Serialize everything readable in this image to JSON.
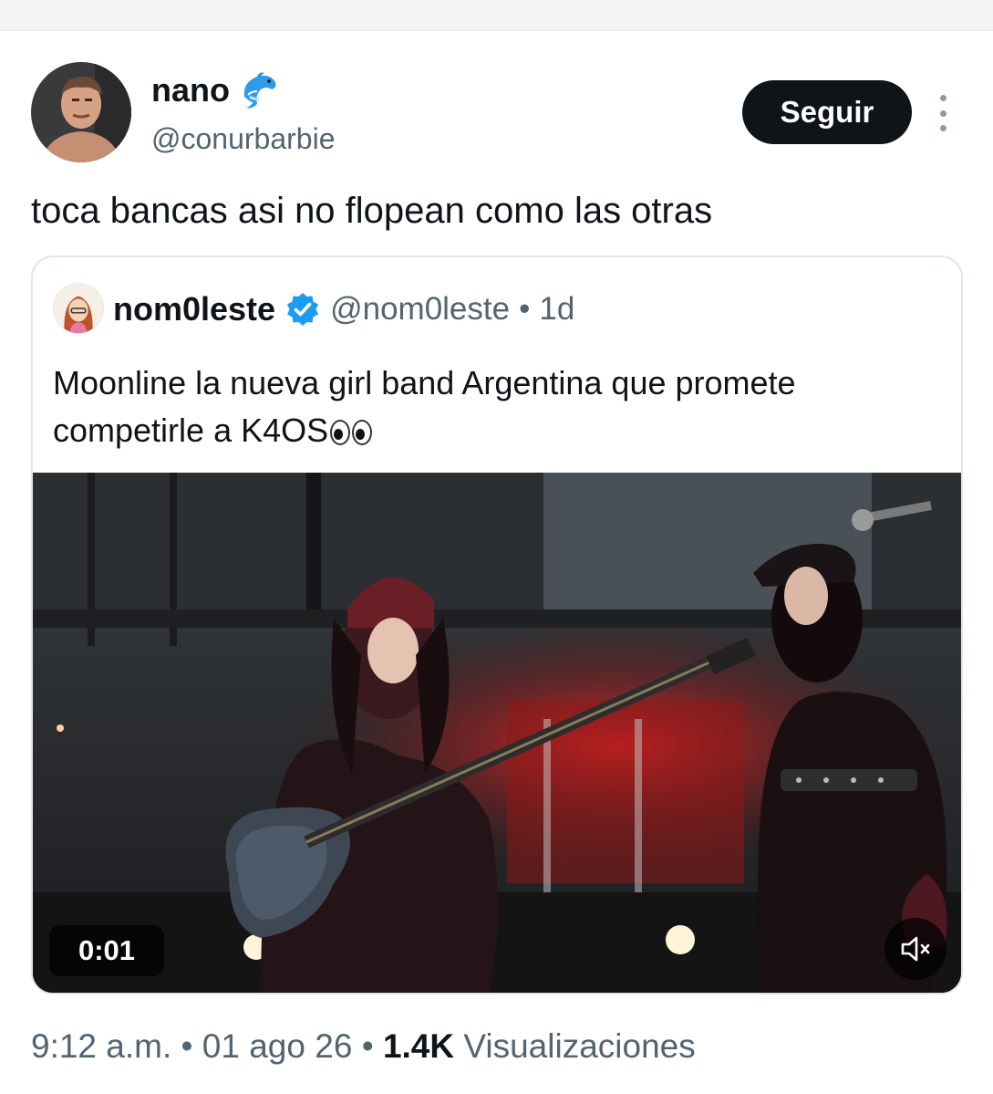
{
  "author": {
    "name": "nano",
    "handle": "@conurbarbie",
    "badge_icon": "dolphin-emoji",
    "follow_label": "Seguir"
  },
  "tweet": {
    "text": "toca bancas asi no flopean como las otras"
  },
  "quoted": {
    "name": "nom0leste",
    "verified": true,
    "handle": "@nom0leste",
    "separator": "•",
    "time": "1d",
    "text": "Moonline la nueva girl band Argentina que promete competirle a K4OS",
    "emoji": "eyes",
    "video": {
      "duration": "0:01",
      "muted": true
    }
  },
  "meta": {
    "time": "9:12 a.m.",
    "dot": "•",
    "date": "01 ago 26",
    "views_count": "1.4K",
    "views_label": "Visualizaciones"
  },
  "colors": {
    "accent": "#1d9bf0",
    "text_primary": "#0f1419",
    "text_secondary": "#536471",
    "button_bg": "#0f1419"
  }
}
